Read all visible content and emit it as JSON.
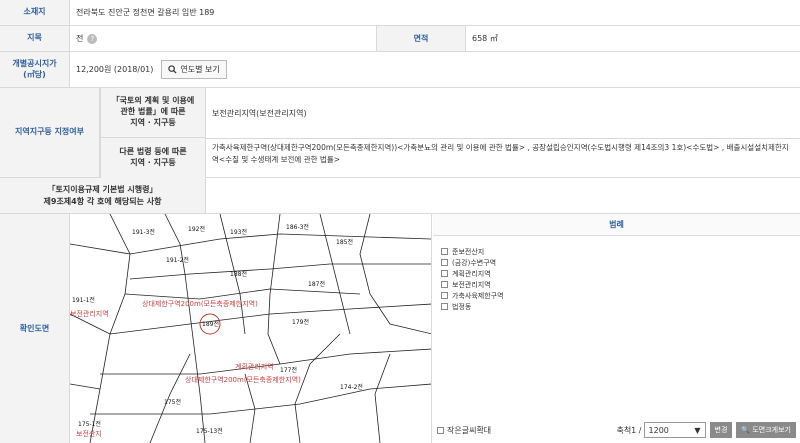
{
  "location": {
    "label": "소재지",
    "value": "전라북도 진안군 정천면 갈용리 임반 189"
  },
  "land": {
    "category_label": "지목",
    "category_value": "전",
    "area_label": "면적",
    "area_value": "658 ㎡"
  },
  "price": {
    "label": "개별공시지가\n(㎡당)",
    "value": "12,200원 (2018/01)",
    "button": "연도별 보기"
  },
  "zoning": {
    "label": "지역지구등 지정여부",
    "law1_label": "「국토의 계획 및 이용에\n관한 법률」에 따른\n지역 · 지구등",
    "law1_value": "보전관리지역(보전관리지역)",
    "law2_label": "다른 법령 등에 따른\n지역 · 지구등",
    "law2_value": "가축사육제한구역(상대제한구역200m(모든축종제한지역))<가축분뇨의 관리 및 이용에 관한 법률> , 공장설립승인지역(수도법시행령 제14조의3 1호)<수도법> , 배출시설설치제한지역<수질 및 수생태계 보전에 관한 법률>"
  },
  "enforcement": {
    "label": "「토지이용규제 기본법 시행령」\n제9조제4항 각 호에 해당되는 사항",
    "value": ""
  },
  "map": {
    "label": "확인도면",
    "parcels": [
      "192전",
      "191-3전",
      "193전",
      "186-3전",
      "185전",
      "191-2전",
      "188전",
      "187전",
      "191-1전",
      "189전",
      "179전",
      "175전",
      "175-13전",
      "177전",
      "174-2전",
      "175-1전"
    ],
    "annotations": [
      "상대제한구역200m(모든축종제한지역)",
      "보전관리지역",
      "계획관리지역",
      "상대제한구역200m(모든축종제한지역)",
      "보전산지"
    ]
  },
  "legend": {
    "title": "범례",
    "items": [
      {
        "label": "준보전산지",
        "color": "#ffffff"
      },
      {
        "label": "(금강)수변구역",
        "color": "#ffffff"
      },
      {
        "label": "계획관리지역",
        "color": "#ffffff"
      },
      {
        "label": "보전관리지역",
        "color": "#ffffff"
      },
      {
        "label": "가축사육제한구역",
        "color": "#ffffff"
      },
      {
        "label": "법정동",
        "color": "#ffffff"
      }
    ]
  },
  "controls": {
    "zoom_checkbox": "작은글씨확대",
    "scale_label": "축척1 /",
    "scale_value": "1200",
    "change_button": "변경",
    "print_button": "도면크게보기"
  }
}
